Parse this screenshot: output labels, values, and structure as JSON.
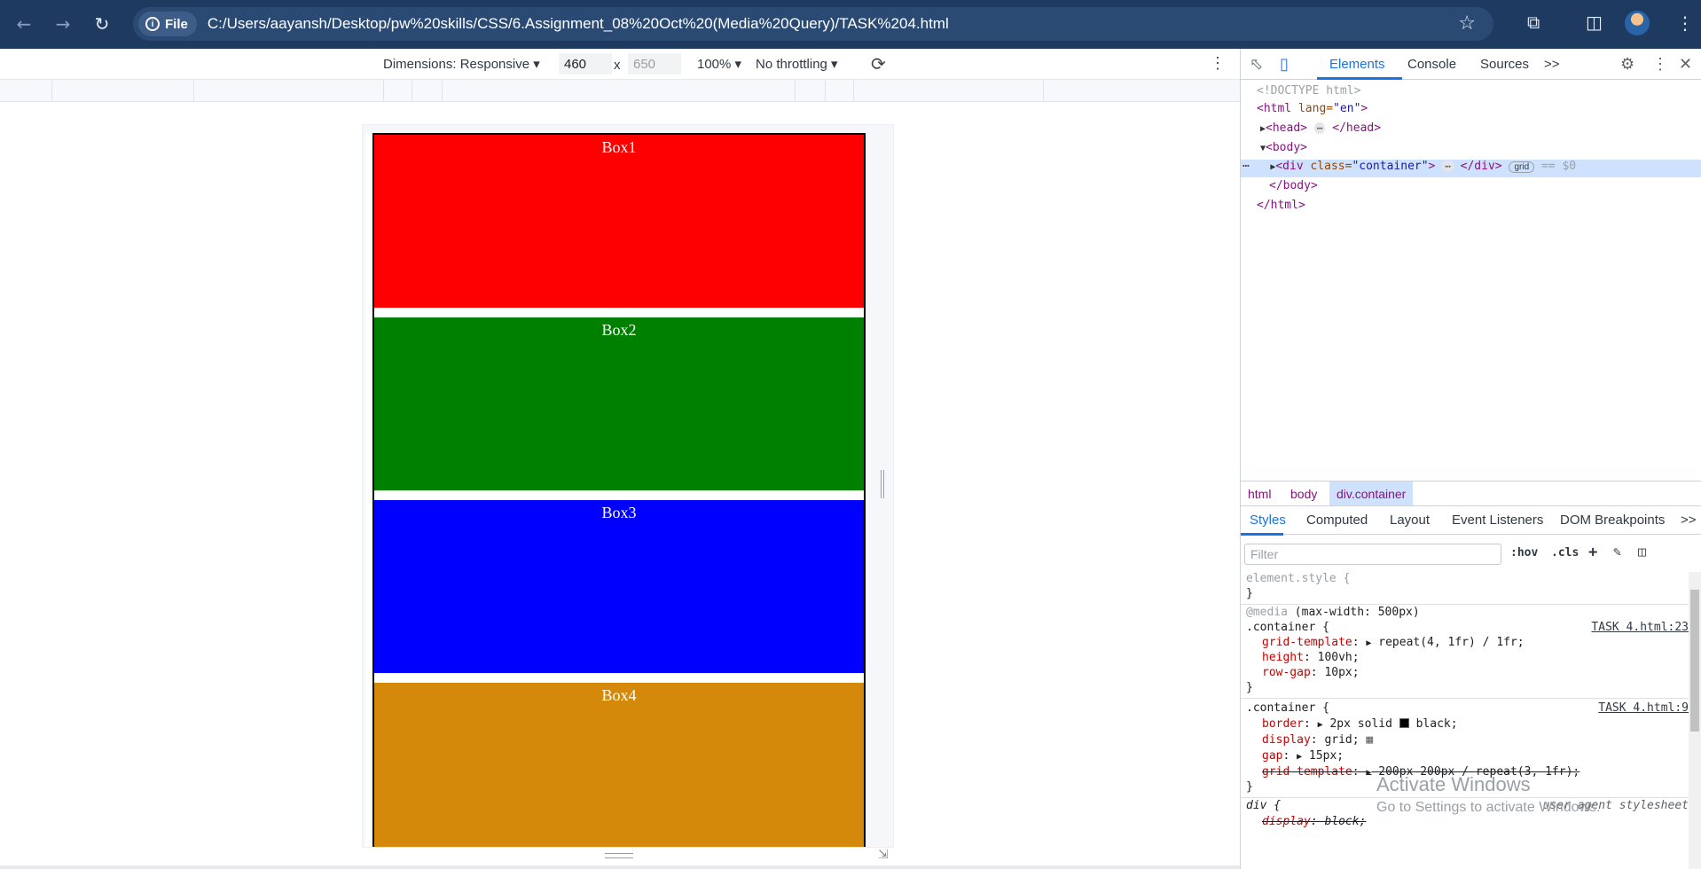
{
  "browser": {
    "file_chip": "File",
    "url": "C:/Users/aayansh/Desktop/pw%20skills/CSS/6.Assignment_08%20Oct%20(Media%20Query)/TASK%204.html"
  },
  "device_toolbar": {
    "dimensions": "Dimensions: Responsive",
    "width": "460",
    "times": "x",
    "height": "650",
    "zoom": "100%",
    "throttling": "No throttling"
  },
  "page": {
    "boxes": [
      {
        "label": "Box1",
        "color": "#ff0000"
      },
      {
        "label": "Box2",
        "color": "#008000"
      },
      {
        "label": "Box3",
        "color": "#0000ff"
      },
      {
        "label": "Box4",
        "color": "#d4890a"
      }
    ]
  },
  "devtools": {
    "tabs": [
      "Elements",
      "Console",
      "Sources"
    ],
    "more_tabs": ">>",
    "dom": {
      "doctype": "<!DOCTYPE html>",
      "html_open_tag": "<html",
      "html_attr": " lang=",
      "html_attr_val": "\"en\"",
      "html_close_bracket": ">",
      "head_open": "<head>",
      "head_close": "</head>",
      "body_open": "<body>",
      "div_open": "<div",
      "div_attr": " class=",
      "div_attr_val": "\"container\"",
      "div_bracket": ">",
      "div_close": "</div>",
      "grid_badge": "grid",
      "selected_marker": "== $0",
      "body_close": "</body>",
      "html_close": "</html>"
    },
    "breadcrumbs": [
      "html",
      "body",
      "div.container"
    ],
    "sub_tabs": [
      "Styles",
      "Computed",
      "Layout",
      "Event Listeners",
      "DOM Breakpoints"
    ],
    "filter_placeholder": "Filter",
    "hov": ":hov",
    "cls": ".cls",
    "styles": {
      "element_style": "element.style {",
      "close_brace": "}",
      "media_kw": "@media",
      "media_query": " (max-width: 500px)",
      "rule1_selector": ".container {",
      "rule1_source": "TASK 4.html:23",
      "rule1_props": [
        {
          "name": "grid-template",
          "value": "repeat(4, 1fr) / 1fr;"
        },
        {
          "name": "height",
          "value": "100vh;"
        },
        {
          "name": "row-gap",
          "value": "10px;"
        }
      ],
      "rule2_selector": ".container {",
      "rule2_source": "TASK 4.html:9",
      "rule2_props": [
        {
          "name": "border",
          "value": "2px solid "
        },
        {
          "name": "display",
          "value": "grid;"
        },
        {
          "name": "gap",
          "value": "15px;"
        },
        {
          "name": "grid-template",
          "value": "200px 200px / repeat(3, 1fr);"
        }
      ],
      "border_color_word": "black;",
      "rule3_selector": "div {",
      "rule3_source": "user agent stylesheet",
      "rule3_prop_name": "display",
      "rule3_prop_value": "block;"
    }
  },
  "watermark": {
    "line1": "Activate Windows",
    "line2": "Go to Settings to activate Windows."
  }
}
